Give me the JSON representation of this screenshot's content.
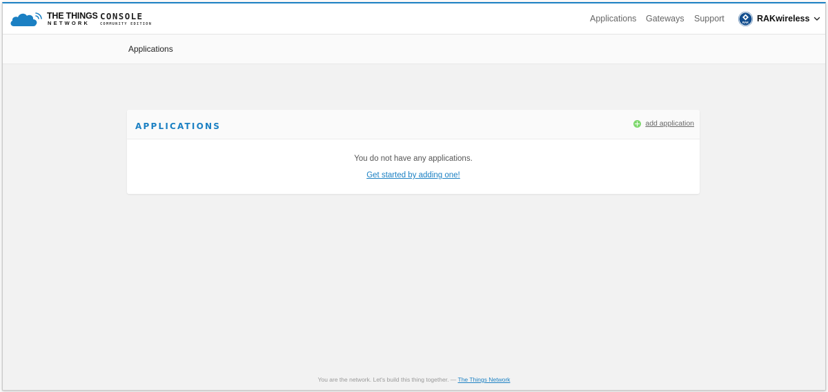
{
  "brand": {
    "logo_line1": "THE THINGS",
    "logo_line2": "NETWORK",
    "console_title": "CONSOLE",
    "console_subtitle": "COMMUNITY EDITION",
    "accent_color": "#1b80c3"
  },
  "nav": {
    "items": [
      {
        "label": "Applications"
      },
      {
        "label": "Gateways"
      },
      {
        "label": "Support"
      }
    ],
    "user": {
      "name": "RAKwireless",
      "avatar_text": "RAK"
    }
  },
  "breadcrumb": {
    "current": "Applications"
  },
  "applications_card": {
    "title": "APPLICATIONS",
    "add_label": "add application",
    "empty_message": "You do not have any applications.",
    "get_started_link": "Get started by adding one!"
  },
  "footer": {
    "text": "You are the network. Let's build this thing together. — ",
    "link_text": "The Things Network"
  },
  "icons": {
    "logo": "cloud-signal-icon",
    "user_menu": "chevron-down-icon",
    "add": "plus-circle-icon"
  }
}
